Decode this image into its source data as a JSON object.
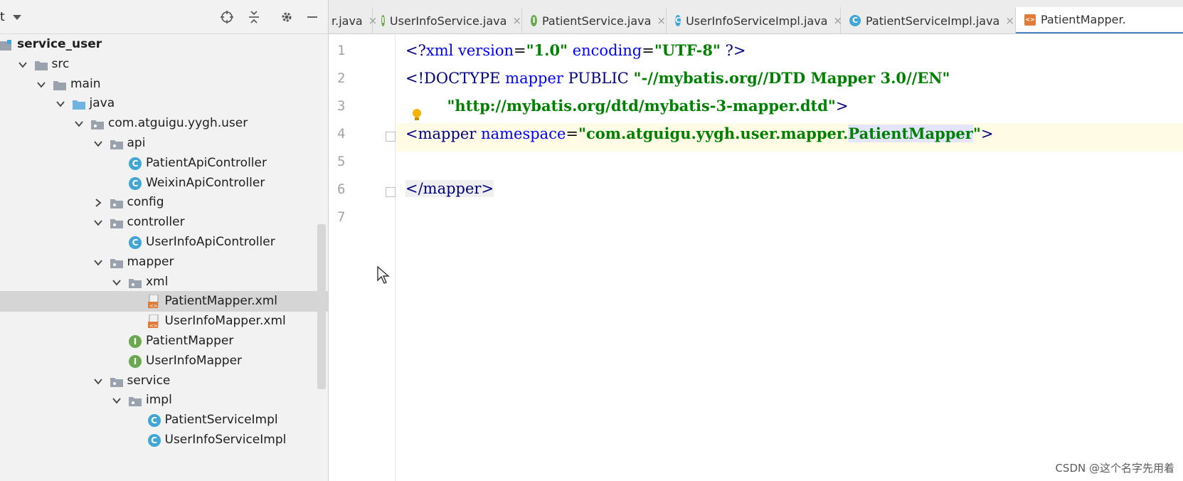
{
  "project_panel": {
    "title": "t",
    "tree": [
      {
        "label": "service_user",
        "indent": 0,
        "type": "module",
        "expanded": true,
        "bold": true
      },
      {
        "label": "src",
        "indent": 1,
        "type": "folder",
        "expanded": true
      },
      {
        "label": "main",
        "indent": 2,
        "type": "folder",
        "expanded": true
      },
      {
        "label": "java",
        "indent": 3,
        "type": "source-folder",
        "expanded": true
      },
      {
        "label": "com.atguigu.yygh.user",
        "indent": 4,
        "type": "package",
        "expanded": true
      },
      {
        "label": "api",
        "indent": 5,
        "type": "package",
        "expanded": true
      },
      {
        "label": "PatientApiController",
        "indent": 6,
        "type": "class"
      },
      {
        "label": "WeixinApiController",
        "indent": 6,
        "type": "class"
      },
      {
        "label": "config",
        "indent": 5,
        "type": "package",
        "expanded": false
      },
      {
        "label": "controller",
        "indent": 5,
        "type": "package",
        "expanded": true
      },
      {
        "label": "UserInfoApiController",
        "indent": 6,
        "type": "class"
      },
      {
        "label": "mapper",
        "indent": 5,
        "type": "package",
        "expanded": true
      },
      {
        "label": "xml",
        "indent": 6,
        "type": "package",
        "expanded": true
      },
      {
        "label": "PatientMapper.xml",
        "indent": 7,
        "type": "xml",
        "selected": true
      },
      {
        "label": "UserInfoMapper.xml",
        "indent": 7,
        "type": "xml"
      },
      {
        "label": "PatientMapper",
        "indent": 6,
        "type": "interface"
      },
      {
        "label": "UserInfoMapper",
        "indent": 6,
        "type": "interface"
      },
      {
        "label": "service",
        "indent": 5,
        "type": "package",
        "expanded": true
      },
      {
        "label": "impl",
        "indent": 6,
        "type": "package",
        "expanded": true
      },
      {
        "label": "PatientServiceImpl",
        "indent": 7,
        "type": "class"
      },
      {
        "label": "UserInfoServiceImpl",
        "indent": 7,
        "type": "class"
      }
    ]
  },
  "tabs": [
    {
      "label": "r.java",
      "icon": "none"
    },
    {
      "label": "UserInfoService.java",
      "icon": "interface"
    },
    {
      "label": "PatientService.java",
      "icon": "interface"
    },
    {
      "label": "UserInfoServiceImpl.java",
      "icon": "class"
    },
    {
      "label": "PatientServiceImpl.java",
      "icon": "class"
    },
    {
      "label": "PatientMapper.",
      "icon": "xml",
      "active": true
    }
  ],
  "editor": {
    "line_numbers": [
      "1",
      "2",
      "3",
      "4",
      "5",
      "6",
      "7"
    ],
    "lines": [
      {
        "p1": "<?",
        "p2": "xml version",
        "p3": "=",
        "p4": "\"1.0\"",
        "p5": " encoding",
        "p6": "=",
        "p7": "\"UTF-8\"",
        "p8": " ?>"
      },
      {
        "p1": "<!DOCTYPE ",
        "p2": "mapper",
        "p3": " PUBLIC ",
        "p4": "\"-//mybatis.org//DTD Mapper 3.0//EN\""
      },
      {
        "p1": "        \"http://mybatis.org/dtd/mybatis-3-mapper.dtd\"",
        "p2": ">"
      },
      {
        "p1": "<",
        "p2": "mapper",
        "p3": " namespace",
        "p4": "=",
        "p5": "\"com.atguigu.yygh.user.mapper.",
        "p6": "PatientMapper",
        "p7": "\"",
        "p8": ">"
      },
      {},
      {
        "p1": "</",
        "p2": "mapper",
        "p3": ">"
      },
      {}
    ]
  },
  "watermark": "CSDN @这个名字先用着",
  "colors": {
    "class_icon": "#3fa6d6",
    "interface_icon": "#6aa84f",
    "xml_icon": "#e07b39",
    "folder": "#9aa3ad",
    "source_folder": "#6fb3e0"
  }
}
